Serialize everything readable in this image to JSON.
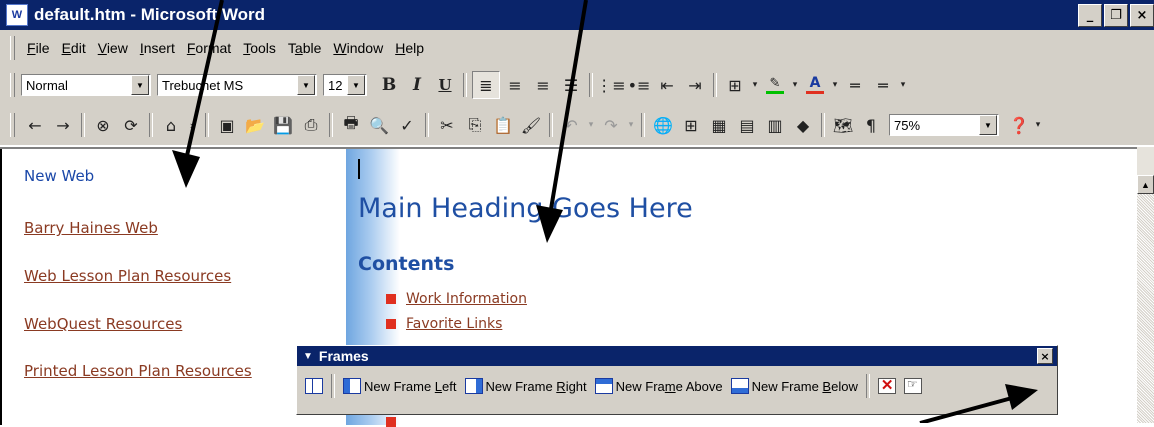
{
  "window": {
    "title": "default.htm - Microsoft Word",
    "icon": "word-doc-icon"
  },
  "window_controls": {
    "minimize": "_",
    "maximize": "🗗",
    "close": "×"
  },
  "menu": [
    {
      "pre": "",
      "u": "F",
      "post": "ile"
    },
    {
      "pre": "",
      "u": "E",
      "post": "dit"
    },
    {
      "pre": "",
      "u": "V",
      "post": "iew"
    },
    {
      "pre": "",
      "u": "I",
      "post": "nsert"
    },
    {
      "pre": "",
      "u": "F",
      "post": "ormat"
    },
    {
      "pre": "",
      "u": "T",
      "post": "ools"
    },
    {
      "pre": "T",
      "u": "a",
      "post": "ble"
    },
    {
      "pre": "",
      "u": "W",
      "post": "indow"
    },
    {
      "pre": "",
      "u": "H",
      "post": "elp"
    }
  ],
  "formatting": {
    "style": "Normal",
    "font": "Trebuchet MS",
    "size": "12",
    "bold": "B",
    "italic": "I",
    "underline": "U",
    "highlight_color": "#00c000",
    "font_color": "#e03020"
  },
  "standard": {
    "zoom": "75%",
    "show_hide": "¶"
  },
  "left_frame": {
    "items": [
      {
        "label": "New Web",
        "link": false
      },
      {
        "label": "Barry Haines Web",
        "link": true
      },
      {
        "label": "Web Lesson Plan Resources",
        "link": true
      },
      {
        "label": "WebQuest Resources",
        "link": true
      },
      {
        "label": "Printed Lesson Plan Resources",
        "link": true
      }
    ]
  },
  "right_frame": {
    "heading": "Main Heading Goes Here",
    "contents_title": "Contents",
    "contents": [
      "Work Information",
      "Favorite Links"
    ],
    "colors": {
      "heading": "#1f4fa3",
      "bullet": "#e03020",
      "link": "#8a3a22"
    }
  },
  "frames_toolbar": {
    "title": "Frames",
    "close": "×",
    "buttons": [
      {
        "pre": "New Frame ",
        "u": "L",
        "post": "eft",
        "icon": "frame-left-icon"
      },
      {
        "pre": "New Frame ",
        "u": "R",
        "post": "ight",
        "icon": "frame-right-icon"
      },
      {
        "pre": "New Fra",
        "u": "m",
        "post": "e Above",
        "icon": "frame-above-icon"
      },
      {
        "pre": "New Frame ",
        "u": "B",
        "post": "elow",
        "icon": "frame-below-icon"
      }
    ]
  }
}
